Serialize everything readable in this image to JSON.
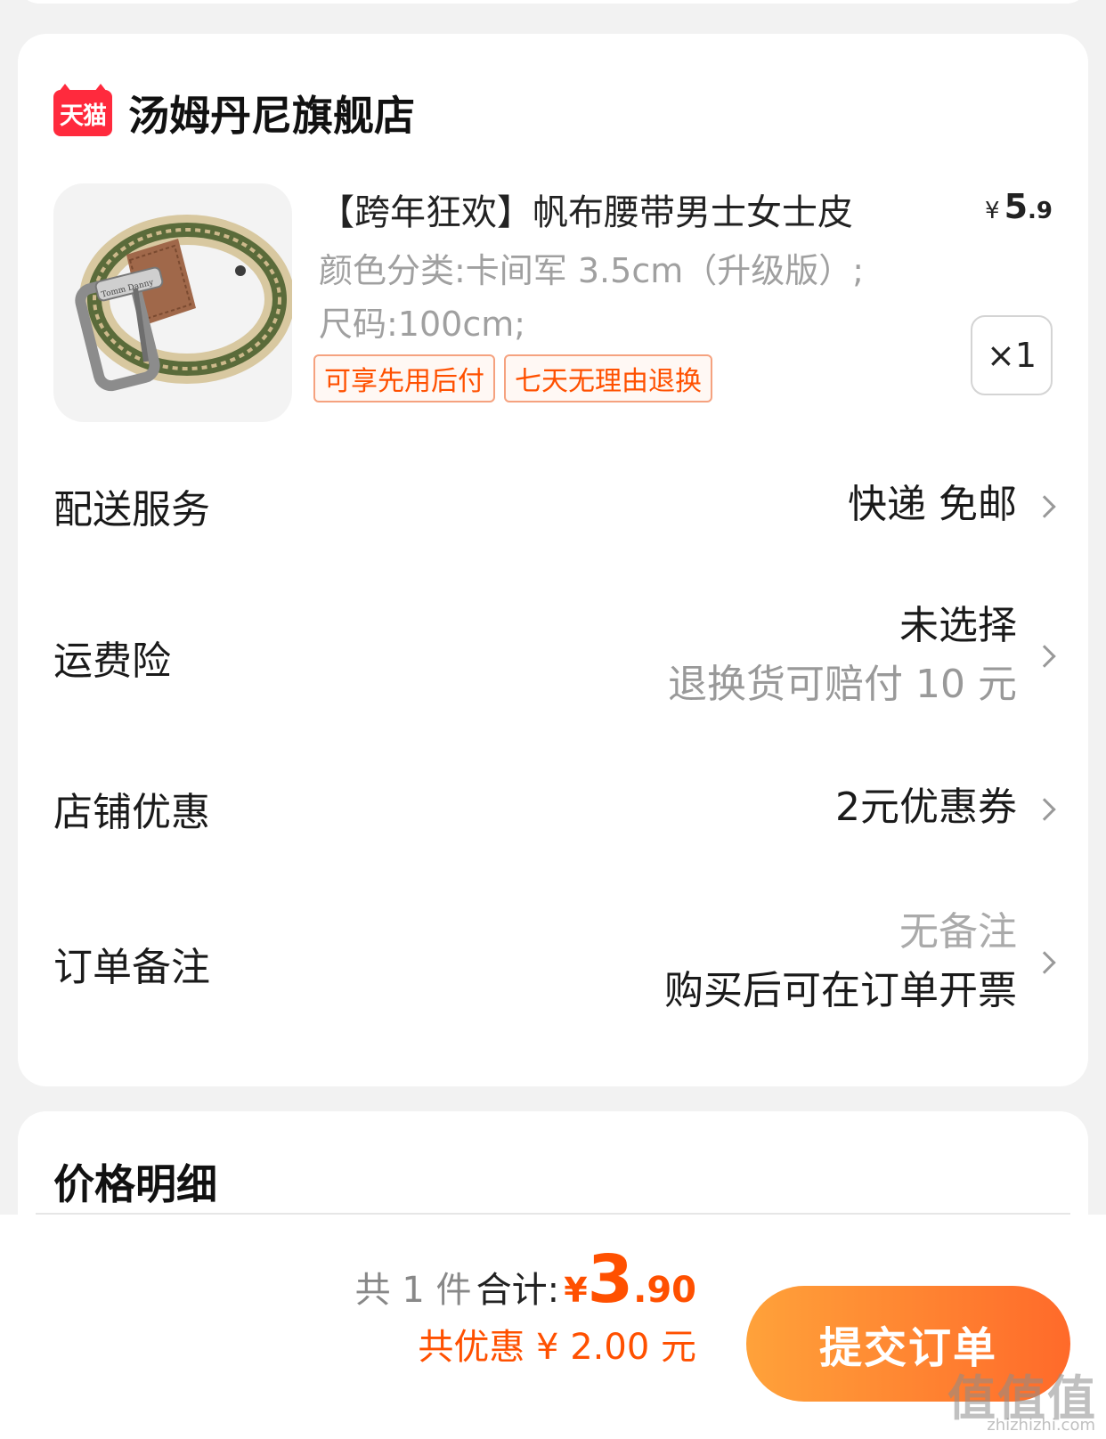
{
  "shop": {
    "logo_text": "天猫",
    "name": "汤姆丹尼旗舰店"
  },
  "product": {
    "title": "【跨年狂欢】帆布腰带男士女士皮",
    "price_symbol": "¥",
    "price_int": "5",
    "price_dec": ".9",
    "sku_color": "颜色分类:卡间军 3.5cm（升级版）;",
    "sku_size": "尺码:100cm;",
    "tags": [
      "可享先用后付",
      "七天无理由退换"
    ],
    "quantity": "×1",
    "image_brand_text": "Tomm Danny"
  },
  "rows": {
    "delivery": {
      "label": "配送服务",
      "value": "快递 免邮"
    },
    "insurance": {
      "label": "运费险",
      "value": "未选择",
      "sub": "退换货可赔付 10 元"
    },
    "store_discount": {
      "label": "店铺优惠",
      "value": "2元优惠券"
    },
    "note": {
      "label": "订单备注",
      "value": "无备注",
      "sub": "购买后可在订单开票"
    }
  },
  "price_detail": {
    "title": "价格明细"
  },
  "footer": {
    "count": "共 1 件",
    "total_label": "合计:",
    "currency": "¥",
    "total_int": "3",
    "total_dec": ".90",
    "discount": "共优惠 ¥ 2.00 元",
    "submit": "提交订单"
  },
  "watermark": {
    "text": "值值值",
    "url": "zhizhizhi.com"
  },
  "colors": {
    "accent": "#ff5000",
    "tmall_red": "#ff2a3d",
    "submit_start": "#ffa23a",
    "submit_end": "#ff6a2a"
  }
}
